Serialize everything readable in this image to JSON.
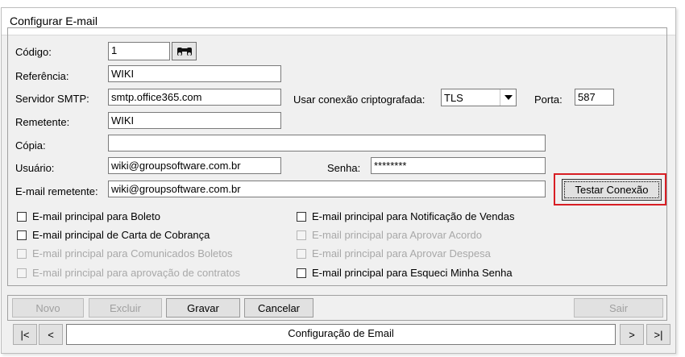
{
  "window": {
    "title": "Configurar E-mail"
  },
  "form": {
    "codigo_label": "Código:",
    "codigo_value": "1",
    "referencia_label": "Referência:",
    "referencia_value": "WIKI",
    "smtp_label": "Servidor SMTP:",
    "smtp_value": "smtp.office365.com",
    "crypto_label": "Usar conexão criptografada:",
    "crypto_value": "TLS",
    "porta_label": "Porta:",
    "porta_value": "587",
    "remetente_label": "Remetente:",
    "remetente_value": "WIKI",
    "copia_label": "Cópia:",
    "copia_value": "",
    "usuario_label": "Usuário:",
    "usuario_value": "wiki@groupsoftware.com.br",
    "senha_label": "Senha:",
    "senha_value": "********",
    "email_remetente_label": "E-mail remetente:",
    "email_remetente_value": "wiki@groupsoftware.com.br",
    "test_button": "Testar Conexão"
  },
  "checkboxes_left": [
    {
      "label": "E-mail principal para Boleto",
      "enabled": true,
      "checked": false
    },
    {
      "label": "E-mail principal de Carta de Cobrança",
      "enabled": true,
      "checked": false
    },
    {
      "label": "E-mail principal para Comunicados Boletos",
      "enabled": false,
      "checked": false
    },
    {
      "label": "E-mail principal para aprovação de contratos",
      "enabled": false,
      "checked": false
    }
  ],
  "checkboxes_right": [
    {
      "label": "E-mail principal para Notificação de Vendas",
      "enabled": true,
      "checked": false
    },
    {
      "label": "E-mail principal para Aprovar Acordo",
      "enabled": false,
      "checked": false
    },
    {
      "label": "E-mail principal para Aprovar Despesa",
      "enabled": false,
      "checked": false
    },
    {
      "label": "E-mail principal para Esqueci Minha Senha",
      "enabled": true,
      "checked": false
    }
  ],
  "actions": {
    "novo": "Novo",
    "excluir": "Excluir",
    "gravar": "Gravar",
    "cancelar": "Cancelar",
    "sair": "Sair"
  },
  "navigator": {
    "first": "|<",
    "prev": "<",
    "status": "Configuração de Email",
    "next": ">",
    "last": ">|"
  },
  "colors": {
    "highlight": "#d81e24",
    "window_bg": "#f0f0f0"
  },
  "icons": {
    "find": "binoculars-icon",
    "dropdown": "chevron-down-icon"
  }
}
